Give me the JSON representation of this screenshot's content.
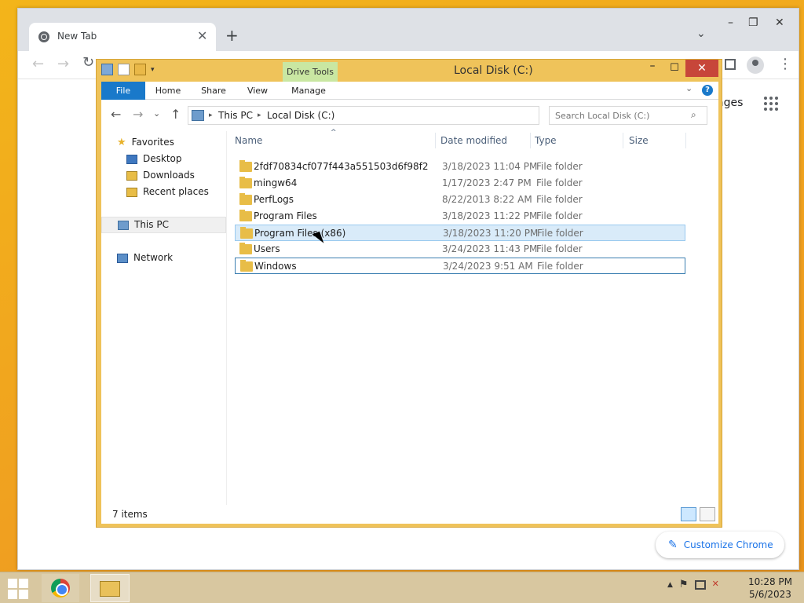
{
  "chrome": {
    "tab_title": "New Tab",
    "tab_close": "✕",
    "new_tab": "+",
    "tab_search": "⌄",
    "win_min": "–",
    "win_max": "❐",
    "win_close": "✕",
    "back": "←",
    "forward": "→",
    "reload": "↻",
    "menu": "⋮",
    "images_link": "ages",
    "customize_label": "Customize Chrome",
    "customize_icon": "✎"
  },
  "explorer": {
    "title": "Local Disk (C:)",
    "contextual_tab_group": "Drive Tools",
    "ribbon_tabs": [
      "File",
      "Home",
      "Share",
      "View",
      "Manage"
    ],
    "ribbon_expand": "⌄",
    "help": "?",
    "min": "–",
    "max": "☐",
    "close": "✕",
    "nav": {
      "back": "←",
      "forward": "→",
      "recent": "⌄",
      "up": "↑"
    },
    "address": {
      "crumb_this_pc": "This PC",
      "crumb_local_disk": "Local Disk (C:)",
      "sep": "▸",
      "dropdown": "⌄",
      "refresh": "↻"
    },
    "search": {
      "placeholder": "Search Local Disk (C:)",
      "icon": "⌕"
    },
    "navpane": {
      "favorites": "Favorites",
      "desktop": "Desktop",
      "downloads": "Downloads",
      "recent_places": "Recent places",
      "this_pc": "This PC",
      "network": "Network"
    },
    "columns": {
      "name": "Name",
      "date_modified": "Date modified",
      "type": "Type",
      "size": "Size",
      "sort_indicator": "^"
    },
    "rows": [
      {
        "name": "2fdf70834cf077f443a551503d6f98f2",
        "date": "3/18/2023 11:04 PM",
        "type": "File folder"
      },
      {
        "name": "mingw64",
        "date": "1/17/2023 2:47 PM",
        "type": "File folder"
      },
      {
        "name": "PerfLogs",
        "date": "8/22/2013 8:22 AM",
        "type": "File folder"
      },
      {
        "name": "Program Files",
        "date": "3/18/2023 11:22 PM",
        "type": "File folder"
      },
      {
        "name": "Program Files (x86)",
        "date": "3/18/2023 11:20 PM",
        "type": "File folder"
      },
      {
        "name": "Users",
        "date": "3/24/2023 11:43 PM",
        "type": "File folder"
      },
      {
        "name": "Windows",
        "date": "3/24/2023 9:51 AM",
        "type": "File folder"
      }
    ],
    "status_items": "7 items"
  },
  "taskbar": {
    "time": "10:28 PM",
    "date": "5/6/2023",
    "tray_up": "▲",
    "tray_flag": "⚑",
    "tray_volume": "✕"
  },
  "colors": {
    "file_tab": "#1979ca",
    "drive_tools": "#c9e7a2",
    "frame": "#efc35a",
    "close": "#c7463a"
  }
}
